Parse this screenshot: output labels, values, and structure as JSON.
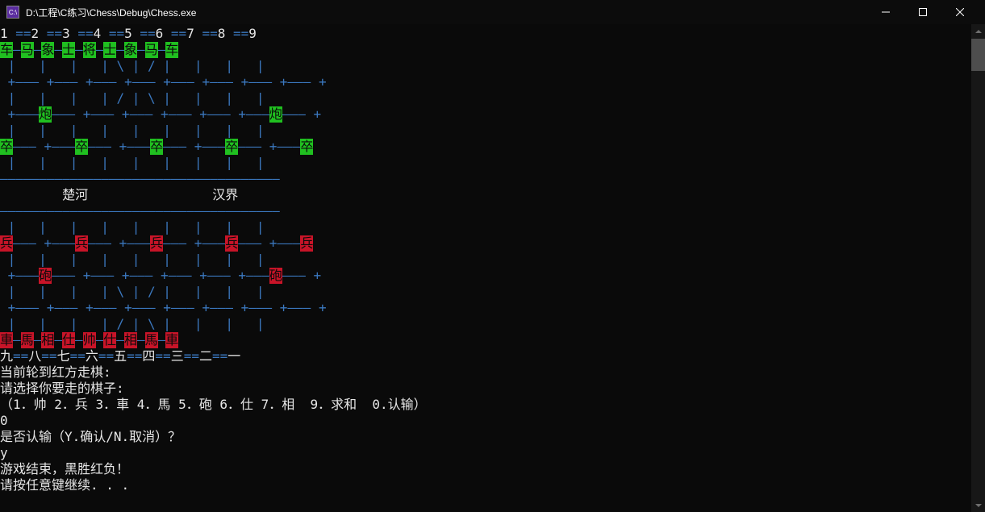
{
  "window": {
    "icon_text": "C:\\",
    "title": "D:\\工程\\C练习\\Chess\\Debug\\Chess.exe"
  },
  "top_coords": {
    "segments": [
      {
        "t": "1 ",
        "c": "white"
      },
      {
        "t": "==",
        "c": "blue"
      },
      {
        "t": "2 ",
        "c": "white"
      },
      {
        "t": "==",
        "c": "blue"
      },
      {
        "t": "3 ",
        "c": "white"
      },
      {
        "t": "==",
        "c": "blue"
      },
      {
        "t": "4 ",
        "c": "white"
      },
      {
        "t": "==",
        "c": "blue"
      },
      {
        "t": "5 ",
        "c": "white"
      },
      {
        "t": "==",
        "c": "blue"
      },
      {
        "t": "6 ",
        "c": "white"
      },
      {
        "t": "==",
        "c": "blue"
      },
      {
        "t": "7 ",
        "c": "white"
      },
      {
        "t": "==",
        "c": "blue"
      },
      {
        "t": "8 ",
        "c": "white"
      },
      {
        "t": "==",
        "c": "blue"
      },
      {
        "t": "9",
        "c": "white"
      }
    ]
  },
  "board_rows": [
    {
      "type": "pieces",
      "cells": [
        {
          "p": "车",
          "s": "g"
        },
        {
          "c": "—"
        },
        {
          "p": "马",
          "s": "g"
        },
        {
          "c": "—"
        },
        {
          "p": "象",
          "s": "g"
        },
        {
          "c": "—"
        },
        {
          "p": "士",
          "s": "g"
        },
        {
          "c": "—"
        },
        {
          "p": "将",
          "s": "g"
        },
        {
          "c": "—"
        },
        {
          "p": "士",
          "s": "g"
        },
        {
          "c": "—"
        },
        {
          "p": "象",
          "s": "g"
        },
        {
          "c": "—"
        },
        {
          "p": "马",
          "s": "g"
        },
        {
          "c": "—"
        },
        {
          "p": "车",
          "s": "g"
        }
      ]
    },
    {
      "type": "verts",
      "diag": "in",
      "text": " |   |   |   | \\ | / |   |   |   | "
    },
    {
      "type": "cross",
      "text": " +——— +——— +——— +——— +——— +——— +——— +——— +"
    },
    {
      "type": "verts",
      "diag": "out",
      "text": " |   |   |   | / | \\ |   |   |   | "
    },
    {
      "type": "pieces",
      "cells": [
        {
          "c": " +"
        },
        {
          "c": "———"
        },
        {
          "p": "炮",
          "s": "g"
        },
        {
          "c": "——— +——— +——— +——— +——— +———"
        },
        {
          "p": "炮",
          "s": "g"
        },
        {
          "c": "——— +"
        }
      ]
    },
    {
      "type": "verts",
      "text": " |   |   |   |   |   |   |   |   | "
    },
    {
      "type": "pieces",
      "cells": [
        {
          "p": "卒",
          "s": "g"
        },
        {
          "c": "——— +———"
        },
        {
          "p": "卒",
          "s": "g"
        },
        {
          "c": "——— +———"
        },
        {
          "p": "卒",
          "s": "g"
        },
        {
          "c": "——— +———"
        },
        {
          "p": "卒",
          "s": "g"
        },
        {
          "c": "——— +———"
        },
        {
          "p": "卒",
          "s": "g"
        }
      ]
    },
    {
      "type": "verts",
      "text": " |   |   |   |   |   |   |   |   | "
    },
    {
      "type": "divider",
      "text": "————————————————————————————————————"
    },
    {
      "type": "river",
      "left": "楚河",
      "right": "汉界"
    },
    {
      "type": "divider",
      "text": "————————————————————————————————————"
    },
    {
      "type": "verts",
      "text": " |   |   |   |   |   |   |   |   | "
    },
    {
      "type": "pieces",
      "cells": [
        {
          "p": "兵",
          "s": "r"
        },
        {
          "c": "——— +———"
        },
        {
          "p": "兵",
          "s": "r"
        },
        {
          "c": "——— +———"
        },
        {
          "p": "兵",
          "s": "r"
        },
        {
          "c": "——— +———"
        },
        {
          "p": "兵",
          "s": "r"
        },
        {
          "c": "——— +———"
        },
        {
          "p": "兵",
          "s": "r"
        }
      ]
    },
    {
      "type": "verts",
      "text": " |   |   |   |   |   |   |   |   | "
    },
    {
      "type": "pieces",
      "cells": [
        {
          "c": " +"
        },
        {
          "c": "———"
        },
        {
          "p": "砲",
          "s": "r"
        },
        {
          "c": "——— +——— +——— +——— +——— +———"
        },
        {
          "p": "砲",
          "s": "r"
        },
        {
          "c": "——— +"
        }
      ]
    },
    {
      "type": "verts",
      "diag": "in",
      "text": " |   |   |   | \\ | / |   |   |   | "
    },
    {
      "type": "cross",
      "text": " +——— +——— +——— +——— +——— +——— +——— +——— +"
    },
    {
      "type": "verts",
      "diag": "out",
      "text": " |   |   |   | / | \\ |   |   |   | "
    },
    {
      "type": "pieces",
      "cells": [
        {
          "p": "車",
          "s": "r"
        },
        {
          "c": "—"
        },
        {
          "p": "馬",
          "s": "r"
        },
        {
          "c": "—"
        },
        {
          "p": "相",
          "s": "r"
        },
        {
          "c": "—"
        },
        {
          "p": "仕",
          "s": "r"
        },
        {
          "c": "—"
        },
        {
          "p": "帅",
          "s": "r"
        },
        {
          "c": "—"
        },
        {
          "p": "仕",
          "s": "r"
        },
        {
          "c": "—"
        },
        {
          "p": "相",
          "s": "r"
        },
        {
          "c": "—"
        },
        {
          "p": "馬",
          "s": "r"
        },
        {
          "c": "—"
        },
        {
          "p": "車",
          "s": "r"
        }
      ]
    }
  ],
  "bottom_coords": {
    "segments": [
      {
        "t": "九",
        "c": "white"
      },
      {
        "t": "==",
        "c": "blue"
      },
      {
        "t": "八",
        "c": "white"
      },
      {
        "t": "==",
        "c": "blue"
      },
      {
        "t": "七",
        "c": "white"
      },
      {
        "t": "==",
        "c": "blue"
      },
      {
        "t": "六",
        "c": "white"
      },
      {
        "t": "==",
        "c": "blue"
      },
      {
        "t": "五",
        "c": "white"
      },
      {
        "t": "==",
        "c": "blue"
      },
      {
        "t": "四",
        "c": "white"
      },
      {
        "t": "==",
        "c": "blue"
      },
      {
        "t": "三",
        "c": "white"
      },
      {
        "t": "==",
        "c": "blue"
      },
      {
        "t": "二",
        "c": "white"
      },
      {
        "t": "==",
        "c": "blue"
      },
      {
        "t": "一",
        "c": "white"
      }
    ]
  },
  "messages": {
    "turn": "当前轮到红方走棋:",
    "prompt_piece": "请选择你要走的棋子:",
    "options": "（1．帅 2．兵 3．車 4．馬 5．砲 6．仕 7．相  9．求和  0.认输）",
    "input1": "0",
    "confirm": "是否认输（Y.确认/N.取消）？",
    "input2": "y",
    "result": "游戏结束，黑胜红负！",
    "press_any": "请按任意键继续. . ."
  }
}
